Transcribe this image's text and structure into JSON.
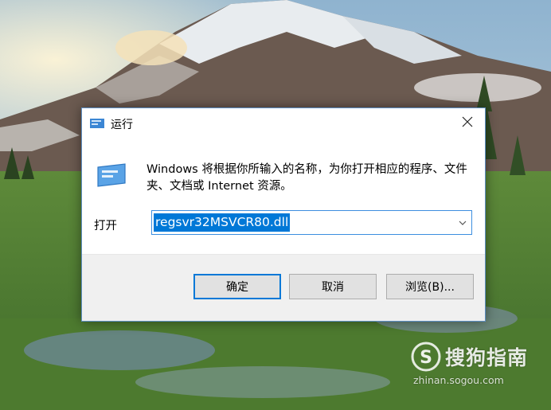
{
  "dialog": {
    "title": "运行",
    "description": "Windows 将根据你所输入的名称，为你打开相应的程序、文件夹、文档或 Internet 资源。",
    "open_label": "打开",
    "command_value": "regsvr32MSVCR80.dll",
    "buttons": {
      "ok": "确定",
      "cancel": "取消",
      "browse": "浏览(B)..."
    },
    "accent_color": "#0078d7"
  },
  "watermark": {
    "brand": "搜狗指南",
    "url": "zhinan.sogou.com"
  },
  "icons": [
    "run-app-icon",
    "close-icon",
    "dropdown-arrow-icon",
    "sogou-logo-icon"
  ]
}
